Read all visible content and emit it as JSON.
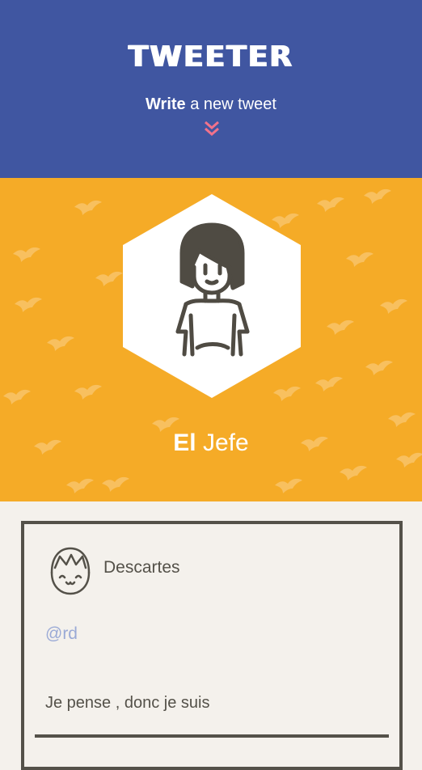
{
  "header": {
    "app_title": "TWEETER",
    "compose_bold": "Write",
    "compose_rest": "a new tweet"
  },
  "profile": {
    "first_name": "El",
    "last_name": "Jefe"
  },
  "tweets": [
    {
      "author": "Descartes",
      "handle": "@rd",
      "text": "Je pense , donc je suis"
    }
  ],
  "colors": {
    "header_bg": "#4056a1",
    "profile_bg": "#f5ab27",
    "page_bg": "#f4f1ec",
    "accent_pink": "#f1728b",
    "handle_blue": "#9aaad6",
    "ink": "#545149"
  },
  "icons": {
    "compose_chevron": "double-chevron-down-icon",
    "profile_avatar": "avatar-icon",
    "tweet_avatar": "avatar-icon",
    "background_pattern": "bird-pattern"
  }
}
